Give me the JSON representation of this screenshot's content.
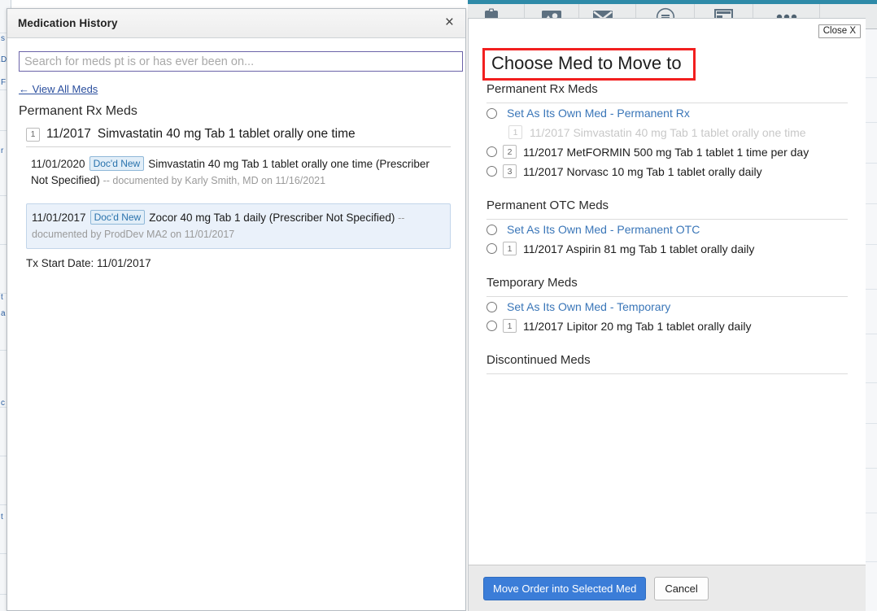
{
  "toolbar": {
    "icons": [
      {
        "name": "clipboard-icon",
        "glyph": "clipboard",
        "has_caret": true
      },
      {
        "name": "image-icon",
        "glyph": "image",
        "has_caret": false
      },
      {
        "name": "envelope-icon",
        "glyph": "envelope",
        "has_caret": true
      },
      {
        "name": "stamp-circle-icon",
        "glyph": "circle",
        "has_caret": false
      },
      {
        "name": "layout-icon",
        "glyph": "layout",
        "has_caret": false
      },
      {
        "name": "more-options-icon",
        "glyph": "ellipsis",
        "has_caret": false
      }
    ],
    "accent_color": "#2e8aa8"
  },
  "med_history": {
    "title": "Medication History",
    "close_label": "×",
    "search": {
      "placeholder": "Search for meds pt is or has ever been on...",
      "value": ""
    },
    "view_all_link": "← View All Meds",
    "section_heading": "Permanent Rx Meds",
    "med": {
      "number": "1",
      "date": "11/2017",
      "description": "Simvastatin 40 mg Tab 1 tablet orally one time"
    },
    "entries": [
      {
        "date": "11/01/2020",
        "badge": "Doc'd New",
        "main": "Simvastatin 40 mg Tab 1 tablet orally one time (Prescriber Not Specified)",
        "meta": "-- documented by Karly Smith, MD on 11/16/2021",
        "selected": false
      },
      {
        "date": "11/01/2017",
        "badge": "Doc'd New",
        "main": "Zocor 40 mg Tab 1 daily (Prescriber Not Specified)",
        "meta": "-- documented by ProdDev MA2 on 11/01/2017",
        "selected": true
      }
    ],
    "tx_start": "Tx Start Date: 11/01/2017"
  },
  "chooser": {
    "title": "Choose Med to Move to",
    "title_border_color": "#f21f1f",
    "close_label": "Close X",
    "groups": [
      {
        "heading": "Permanent Rx Meds",
        "options": [
          {
            "kind": "link",
            "label": "Set As Its Own Med - Permanent Rx",
            "radio": true,
            "number": null,
            "faded": false
          },
          {
            "kind": "med",
            "label": "11/2017 Simvastatin 40 mg Tab 1 tablet orally one time",
            "radio": false,
            "number": "1",
            "faded": true
          },
          {
            "kind": "med",
            "label": "11/2017 MetFORMIN 500 mg Tab 1 tablet 1 time per day",
            "radio": true,
            "number": "2",
            "faded": false
          },
          {
            "kind": "med",
            "label": "11/2017 Norvasc 10 mg Tab 1 tablet orally daily",
            "radio": true,
            "number": "3",
            "faded": false
          }
        ]
      },
      {
        "heading": "Permanent OTC Meds",
        "options": [
          {
            "kind": "link",
            "label": "Set As Its Own Med - Permanent OTC",
            "radio": true,
            "number": null,
            "faded": false
          },
          {
            "kind": "med",
            "label": "11/2017 Aspirin 81 mg Tab 1 tablet orally daily",
            "radio": true,
            "number": "1",
            "faded": false
          }
        ]
      },
      {
        "heading": "Temporary Meds",
        "options": [
          {
            "kind": "link",
            "label": "Set As Its Own Med - Temporary",
            "radio": true,
            "number": null,
            "faded": false
          },
          {
            "kind": "med",
            "label": "11/2017 Lipitor 20 mg Tab 1 tablet orally daily",
            "radio": true,
            "number": "1",
            "faded": false
          }
        ]
      },
      {
        "heading": "Discontinued Meds",
        "options": []
      }
    ],
    "footer": {
      "primary_label": "Move Order into Selected Med",
      "primary_color": "#3b7dd8",
      "cancel_label": "Cancel"
    }
  },
  "background_fragments": {
    "left": [
      "s",
      "D",
      "F",
      "r",
      "t",
      "a",
      "c",
      "t"
    ],
    "right": []
  }
}
